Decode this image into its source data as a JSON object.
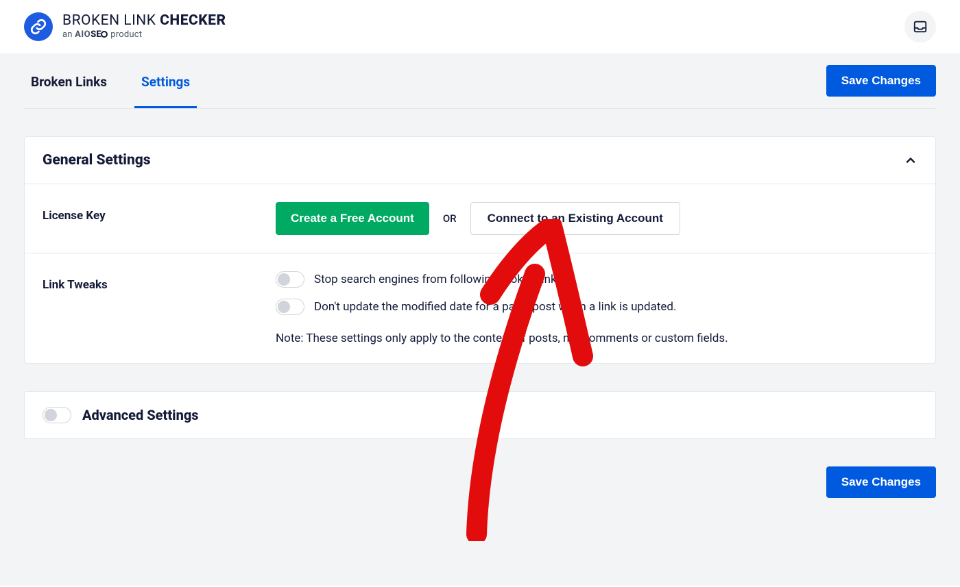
{
  "header": {
    "title_prefix": "BROKEN LINK ",
    "title_bold": "CHECKER",
    "subtitle_prefix": "an ",
    "subtitle_brand_a": "AIO",
    "subtitle_brand_b": "SE",
    "subtitle_suffix": " product"
  },
  "tabs": {
    "broken_links": "Broken Links",
    "settings": "Settings"
  },
  "buttons": {
    "save_changes": "Save Changes",
    "create_free_account": "Create a Free Account",
    "or": "OR",
    "connect_existing": "Connect to an Existing Account"
  },
  "general": {
    "title": "General Settings",
    "license_key_label": "License Key",
    "link_tweaks_label": "Link Tweaks",
    "toggle1": "Stop search engines from following broken links",
    "toggle2": "Don't update the modified date for a page/post when a link is updated.",
    "note": "Note: These settings only apply to the content of posts, not comments or custom fields."
  },
  "advanced": {
    "title": "Advanced Settings"
  }
}
